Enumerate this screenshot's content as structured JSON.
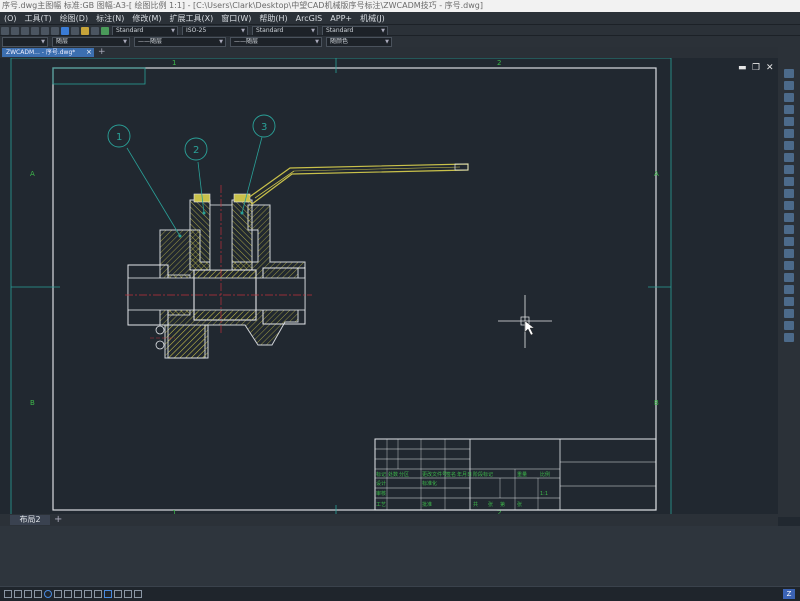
{
  "window": {
    "title": "序号.dwg主图幅  标准:GB  图幅:A3-[ 绘图比例 1:1] - [C:\\Users\\Clark\\Desktop\\中望CAD机械版序号标注\\ZWCADM技巧 - 序号.dwg]"
  },
  "menu": {
    "items": [
      "(O)",
      "工具(T)",
      "绘图(D)",
      "标注(N)",
      "修改(M)",
      "扩展工具(X)",
      "窗口(W)",
      "帮助(H)",
      "ArcGIS",
      "APP+",
      "机械(J)"
    ]
  },
  "toolbar": {
    "text_style": "Standard",
    "dim_style": "ISO-25",
    "table_style": "Standard",
    "multileader_style": "Standard",
    "layer_color": "随层",
    "linetype": "——随层",
    "lineweight": "——随层",
    "plotstyle": "随颜色"
  },
  "tabs": {
    "document": "ZWCADM... - 序号.dwg*",
    "layout": "布局2",
    "add": "+"
  },
  "drawing": {
    "grid_cols": [
      "1",
      "2"
    ],
    "grid_rows": [
      "A",
      "B"
    ],
    "balloons": [
      "1",
      "2",
      "3"
    ]
  },
  "title_block": {
    "cells": [
      "标记",
      "处数",
      "分区",
      "更改文件号",
      "签名",
      "年月日",
      "设计",
      "标准化",
      "审核",
      "工艺",
      "批准",
      "阶段标记",
      "重量",
      "比例",
      "共",
      "张",
      "第",
      "张",
      "1:1"
    ]
  },
  "colors": {
    "canvas": "#212830",
    "frame": "#d9dde1",
    "part_yellow": "#c9c14a",
    "center_red": "#c0303a",
    "leader_teal": "#2aa198",
    "grid_green": "#3db84a"
  }
}
